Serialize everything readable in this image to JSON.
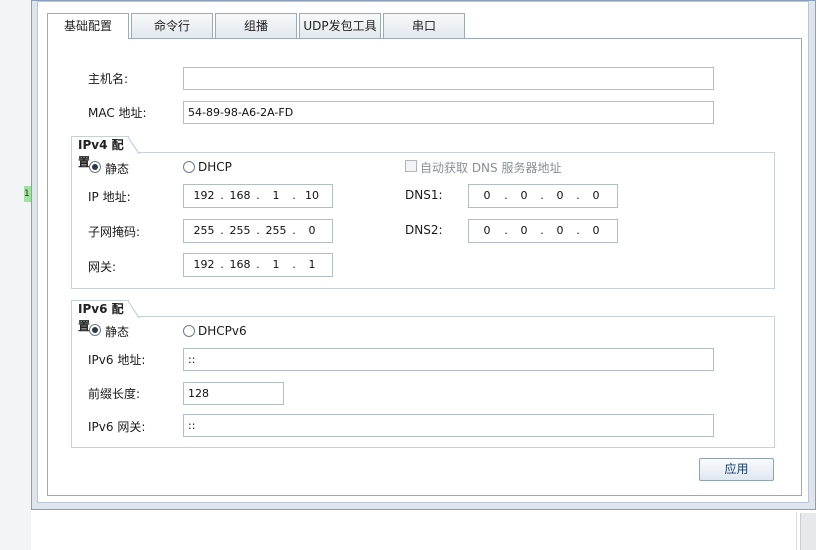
{
  "background": {
    "marker_text": "1"
  },
  "tabs": [
    {
      "label": "基础配置"
    },
    {
      "label": "命令行"
    },
    {
      "label": "组播"
    },
    {
      "label": "UDP发包工具"
    },
    {
      "label": "串口"
    }
  ],
  "basic": {
    "hostname_label": "主机名:",
    "hostname_value": "",
    "mac_label": "MAC 地址:",
    "mac_value": "54-89-98-A6-2A-FD"
  },
  "ipv4": {
    "title": "IPv4 配置",
    "static_label": "静态",
    "dhcp_label": "DHCP",
    "static_selected": true,
    "auto_dns_label": "自动获取 DNS 服务器地址",
    "ip_label": "IP 地址:",
    "ip": [
      "192",
      "168",
      "1",
      "10"
    ],
    "mask_label": "子网掩码:",
    "mask": [
      "255",
      "255",
      "255",
      "0"
    ],
    "gateway_label": "网关:",
    "gateway": [
      "192",
      "168",
      "1",
      "1"
    ],
    "dns1_label": "DNS1:",
    "dns1": [
      "0",
      "0",
      "0",
      "0"
    ],
    "dns2_label": "DNS2:",
    "dns2": [
      "0",
      "0",
      "0",
      "0"
    ]
  },
  "ipv6": {
    "title": "IPv6 配置",
    "static_label": "静态",
    "dhcp_label": "DHCPv6",
    "static_selected": true,
    "addr_label": "IPv6 地址:",
    "addr_value": "::",
    "prefix_label": "前缀长度:",
    "prefix_value": "128",
    "gateway_label": "IPv6 网关:",
    "gateway_value": "::"
  },
  "actions": {
    "apply_label": "应用"
  },
  "colors": {
    "border": "#9aaabb",
    "window_frame": "#dfe5ec",
    "marker": "#9fe39f",
    "button_text": "#1a3f6b"
  }
}
